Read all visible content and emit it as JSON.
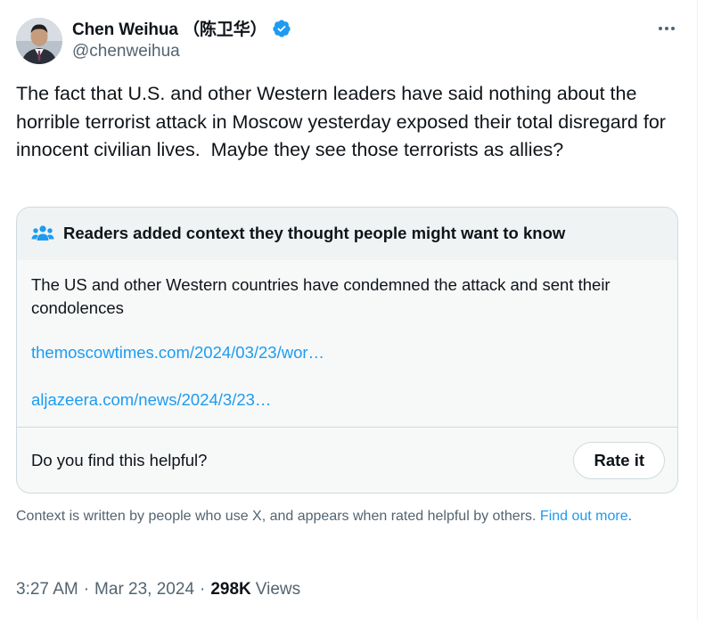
{
  "author": {
    "display_name": "Chen Weihua （陈卫华）",
    "handle": "@chenweihua",
    "verified_badge_color": "#1d9bf0"
  },
  "tweet": {
    "text": "The fact that U.S. and other Western leaders have said nothing about the horrible terrorist attack in Moscow yesterday exposed their total disregard for innocent civilian lives.  Maybe they see those terrorists as allies?",
    "time": "3:27 AM",
    "date": "Mar 23, 2024",
    "views_count": "298K",
    "views_label": "Views"
  },
  "note": {
    "header": "Readers added context they thought people might want to know",
    "body": "The US and other Western countries have condemned the attack and sent their condolences",
    "links": [
      "themoscowtimes.com/2024/03/23/wor…",
      "aljazeera.com/news/2024/3/23…"
    ],
    "helpful_question": "Do you find this helpful?",
    "rate_button": "Rate it"
  },
  "context": {
    "text": "Context is written by people who use X, and appears when rated helpful by others.",
    "link": "Find out more"
  },
  "icons": {
    "more": "more-horizontal-icon",
    "verified": "verified-badge-icon",
    "note_header": "people-icon"
  },
  "colors": {
    "link": "#1d9bf0",
    "secondary_text": "#536471",
    "primary_text": "#0f1419"
  }
}
